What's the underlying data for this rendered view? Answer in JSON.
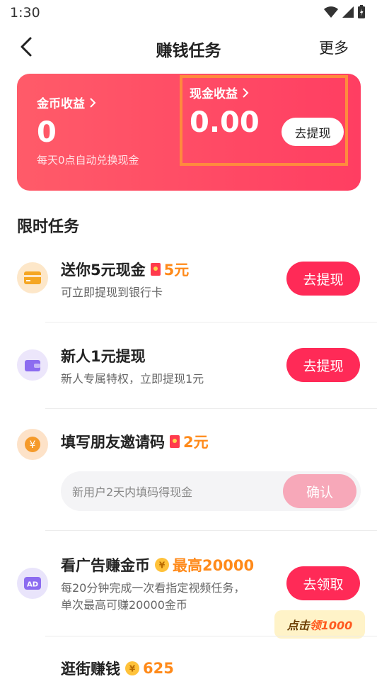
{
  "status": {
    "time": "1:30"
  },
  "nav": {
    "title": "赚钱任务",
    "more": "更多"
  },
  "earnings": {
    "coin_label": "金币收益",
    "coin_value": "0",
    "coin_hint": "每天0点自动兑换现金",
    "cash_label": "现金收益",
    "cash_value": "0.00",
    "withdraw_label": "去提现"
  },
  "section": {
    "title": "限时任务"
  },
  "tasks": [
    {
      "name": "送你5元现金",
      "reward": "5元",
      "desc": "可立即提现到银行卡",
      "button": "去提现",
      "icon": "bank-card-icon"
    },
    {
      "name": "新人1元提现",
      "desc": "新人专属特权，立即提现1元",
      "button": "去提现",
      "icon": "wallet-icon"
    },
    {
      "name": "填写朋友邀请码",
      "reward": "2元",
      "input_placeholder": "新用户2天内填码得现金",
      "button": "确认",
      "icon": "yuan-coin-icon"
    },
    {
      "name": "看广告赚金币",
      "reward": "最高20000",
      "desc_line1": "每20分钟完成一次看指定视频任务，",
      "desc_line2": "单次最高可赚20000金币",
      "button": "去领取",
      "icon": "ad-icon",
      "badge_prefix": "点击",
      "badge_emph": "领1000"
    },
    {
      "name": "逛街赚钱",
      "reward": "625",
      "icon": "shopping-icon"
    }
  ],
  "colors": {
    "accent": "#ff2a57",
    "card_start": "#ff5b69",
    "card_end": "#ff3e62",
    "reward": "#ff8a1a",
    "highlight_box": "#ff8a3d"
  }
}
